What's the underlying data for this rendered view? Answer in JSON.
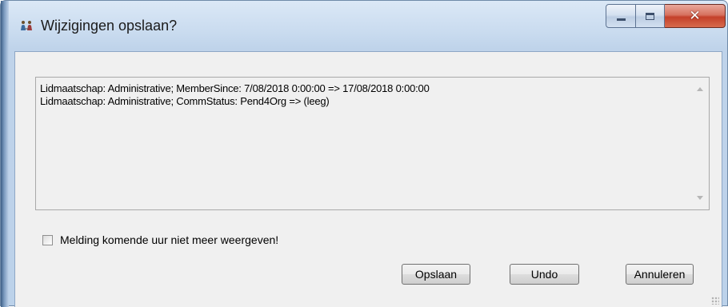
{
  "window": {
    "title": "Wijzigingen opslaan?",
    "app_icon": "people-icon",
    "controls": {
      "minimize": "minimize-icon",
      "maximize": "maximize-icon",
      "close": "close-icon"
    }
  },
  "changes": {
    "lines": [
      "Lidmaatschap: Administrative; MemberSince: 7/08/2018 0:00:00 => 17/08/2018 0:00:00",
      "Lidmaatschap: Administrative; CommStatus: Pend4Org => (leeg)"
    ]
  },
  "suppress_checkbox": {
    "label": "Melding komende uur niet meer weergeven!",
    "checked": false
  },
  "buttons": {
    "save": "Opslaan",
    "undo": "Undo",
    "cancel": "Annuleren"
  },
  "colors": {
    "frame": "#bfd3ea",
    "close_button": "#c4402a",
    "client_bg": "#f0f0f0"
  }
}
